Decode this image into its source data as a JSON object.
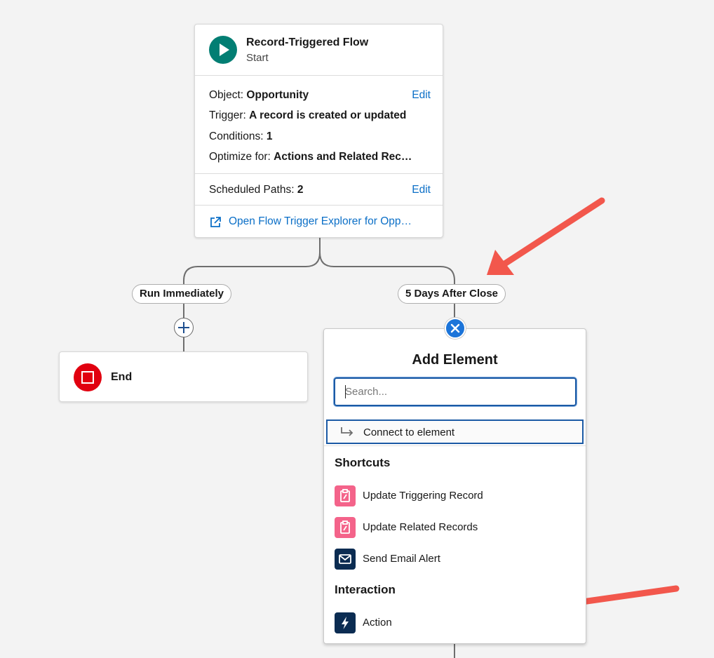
{
  "start": {
    "title": "Record-Triggered Flow",
    "subtitle": "Start",
    "object_label": "Object:",
    "object_value": "Opportunity",
    "trigger_label": "Trigger:",
    "trigger_value": "A record is created or updated",
    "conditions_label": "Conditions:",
    "conditions_value": "1",
    "optimize_label": "Optimize for:",
    "optimize_value": "Actions and Related Rec…",
    "edit_label": "Edit",
    "scheduled_label": "Scheduled Paths:",
    "scheduled_value": "2",
    "explorer_link": "Open Flow Trigger Explorer for Opp…"
  },
  "paths": {
    "left": "Run Immediately",
    "right": "5 Days After Close"
  },
  "end": {
    "label": "End"
  },
  "popup": {
    "title": "Add Element",
    "search_placeholder": "Search...",
    "connect_label": "Connect to element",
    "sections": [
      {
        "title": "Shortcuts",
        "items": [
          {
            "label": "Update Triggering Record",
            "icon": "clipboard-edit-icon"
          },
          {
            "label": "Update Related Records",
            "icon": "clipboard-edit-icon"
          },
          {
            "label": "Send Email Alert",
            "icon": "email-icon"
          }
        ]
      },
      {
        "title": "Interaction",
        "items": [
          {
            "label": "Action",
            "icon": "lightning-icon"
          }
        ]
      }
    ]
  },
  "colors": {
    "start_icon": "#027e73",
    "end_icon": "#e1000f",
    "link": "#0b6fc7",
    "focus_border": "#1b5aa5",
    "record_icon": "#f4638a",
    "action_icon": "#0b2c52",
    "annotation_arrow": "#f2574c"
  }
}
